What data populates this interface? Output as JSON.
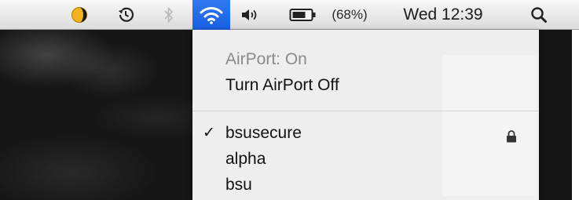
{
  "menubar": {
    "battery_percent": "(68%)",
    "clock": "Wed 12:39",
    "icons": [
      "app-status-icon",
      "time-machine-icon",
      "bluetooth-icon",
      "wifi-icon",
      "volume-icon",
      "battery-icon",
      "spotlight-icon"
    ],
    "wifi_highlight_color": "#2a72ee"
  },
  "airport_menu": {
    "status": "AirPort: On",
    "toggle_label": "Turn AirPort Off",
    "networks": [
      {
        "name": "bsusecure",
        "selected": true,
        "secured": true
      },
      {
        "name": "alpha",
        "selected": false,
        "secured": false
      },
      {
        "name": "bsu",
        "selected": false,
        "secured": false
      }
    ],
    "checkmark": "✓"
  }
}
